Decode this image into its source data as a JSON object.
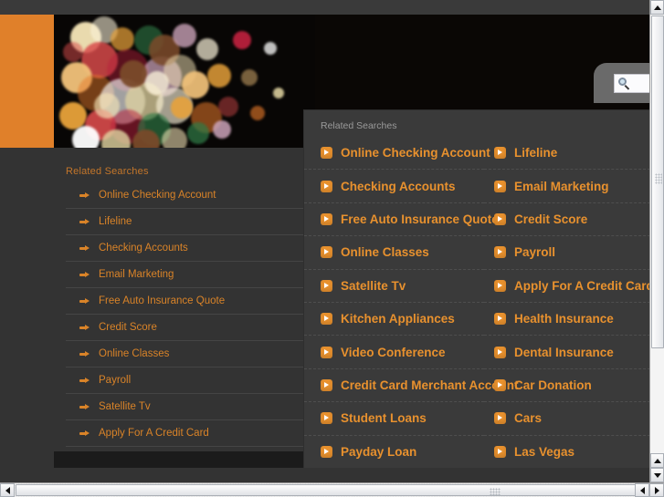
{
  "browser": {
    "vertical_scrollbar": {
      "name": "vertical-scrollbar"
    },
    "horizontal_scrollbar": {
      "name": "horizontal-scrollbar"
    }
  },
  "search": {
    "value": "",
    "placeholder": "",
    "icon": "magnifier-icon"
  },
  "colors": {
    "accent": "#E0802A",
    "link": "#D98328",
    "popup_link": "#E8912E",
    "page_bg": "#333333",
    "popup_bg": "#3a3a3a"
  },
  "sidebar": {
    "title": "Related Searches",
    "items": [
      {
        "label": "Online Checking Account"
      },
      {
        "label": "Lifeline"
      },
      {
        "label": "Checking Accounts"
      },
      {
        "label": "Email Marketing"
      },
      {
        "label": "Free Auto Insurance Quote"
      },
      {
        "label": "Credit Score"
      },
      {
        "label": "Online Classes"
      },
      {
        "label": "Payroll"
      },
      {
        "label": "Satellite Tv"
      },
      {
        "label": "Apply For A Credit Card"
      }
    ]
  },
  "popup": {
    "title": "Related Searches",
    "left_column": [
      {
        "label": "Online Checking Account"
      },
      {
        "label": "Checking Accounts"
      },
      {
        "label": "Free Auto Insurance Quote"
      },
      {
        "label": "Online Classes"
      },
      {
        "label": "Satellite Tv"
      },
      {
        "label": "Kitchen Appliances"
      },
      {
        "label": "Video Conference"
      },
      {
        "label": "Credit Card Merchant Account"
      },
      {
        "label": "Student Loans"
      },
      {
        "label": "Payday Loan"
      }
    ],
    "right_column": [
      {
        "label": "Lifeline"
      },
      {
        "label": "Email Marketing"
      },
      {
        "label": "Credit Score"
      },
      {
        "label": "Payroll"
      },
      {
        "label": "Apply For A Credit Card"
      },
      {
        "label": "Health Insurance"
      },
      {
        "label": "Dental Insurance"
      },
      {
        "label": "Car Donation"
      },
      {
        "label": "Cars"
      },
      {
        "label": "Las Vegas"
      }
    ]
  }
}
